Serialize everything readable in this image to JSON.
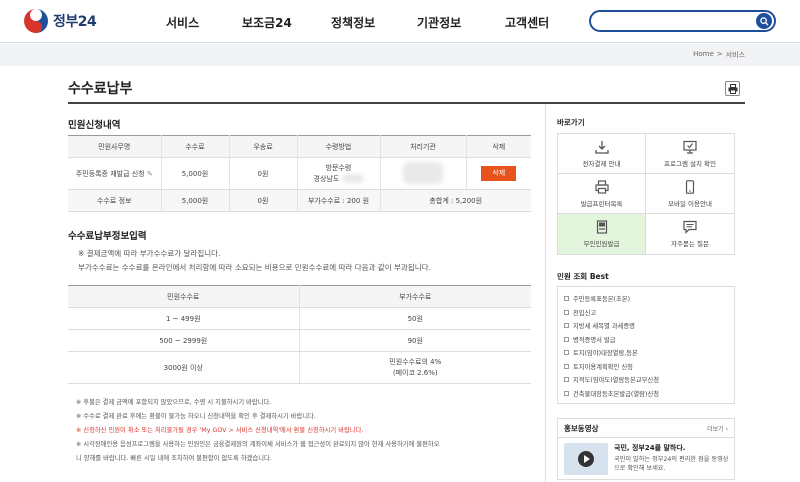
{
  "header": {
    "logo_text": "정부24",
    "nav": [
      "서비스",
      "보조금24",
      "정책정보",
      "기관정보",
      "고객센터"
    ],
    "search_placeholder": ""
  },
  "breadcrumb": [
    "Home",
    ">",
    "서비스"
  ],
  "page_title": "수수료납부",
  "section1": {
    "heading": "민원신청내역",
    "columns": [
      "민원사무명",
      "수수료",
      "우송료",
      "수령방법",
      "처리기관",
      "삭제"
    ],
    "row": {
      "name": "주민등록증 재발급 신청",
      "fee": "5,000원",
      "postage": "0원",
      "method_line1": "방문수령",
      "method_line2": "경상남도",
      "agency": "",
      "delete_label": "삭제"
    },
    "summary": {
      "label": "수수료 정보",
      "fee": "5,000원",
      "postage": "0원",
      "extra": "부가수수료 : 200 원",
      "total": "총합계 : 5,200원"
    }
  },
  "section2": {
    "heading": "수수료납부정보입력",
    "desc1": "※ 결제금액에 따라 부가수수료가 달라집니다.",
    "desc2": "부가수수료는 수수료를 온라인에서 처리함에 따라 소요되는 비용으로 민원수수료에 따라 다음과 같이 부과됩니다.",
    "columns": [
      "민원수수료",
      "부가수수료"
    ],
    "rows": [
      {
        "range": "1 ~ 499원",
        "extra": "50원"
      },
      {
        "range": "500 ~ 2999원",
        "extra": "90원"
      },
      {
        "range": "3000원 이상",
        "extra": "민원수수료의 4%",
        "extra2": "(페이코 2.6%)"
      }
    ]
  },
  "notes": [
    "※ 후불은 결제 금액에 포함되지 않았으므로, 수령 시 지불하시기 바랍니다.",
    "※ 수수료 결제 완료 후에는 환불이 불가능 하오니 신청내역을 확인 후 결제하시기 바랍니다.",
    "※ 신청하신 민원이 취소 또는 처리불가될 경우 'My GOV > 서비스 신청내역'에서 환불 신청하시기 바랍니다.",
    "※ 시각장애인용 음성프로그램을 사용하는 민원인은 금융결제원의 계좌이체 서비스가 웹 접근성이 완료되지 않아 현재 사용하기에 불편하오",
    "니 양해를 바랍니다. 빠른 시일 내에 조치하여 불편함이 없도록 하겠습니다."
  ],
  "sidebar": {
    "quick_heading": "바로가기",
    "quick_items": [
      {
        "label": "전자결제 안내",
        "icon": "download-icon"
      },
      {
        "label": "프로그램 설치 확인",
        "icon": "monitor-check-icon"
      },
      {
        "label": "발급프린터목록",
        "icon": "printer-icon"
      },
      {
        "label": "모바일 이용안내",
        "icon": "mobile-icon"
      },
      {
        "label": "무인민원발급",
        "icon": "kiosk-icon"
      },
      {
        "label": "자주묻는 질문",
        "icon": "chat-icon"
      }
    ],
    "best_heading": "민원 조회 Best",
    "best_items": [
      "주민등록표등본(초본)",
      "전입신고",
      "지방세 세목별 과세증명",
      "병적증명서 발급",
      "토지(임야)대장열람,등본",
      "토지이용계획확인 신청",
      "지적도(임야도)열람등본교부신청",
      "건축물대장등초본발급(열람)신청"
    ],
    "promo": {
      "heading": "홍보동영상",
      "more": "더보기 ›",
      "title": "국민, 정부24를 말하다.",
      "text": "국민이 말하는 정부24의 편리한 점을 동영상으로 확인해 보세요."
    }
  }
}
